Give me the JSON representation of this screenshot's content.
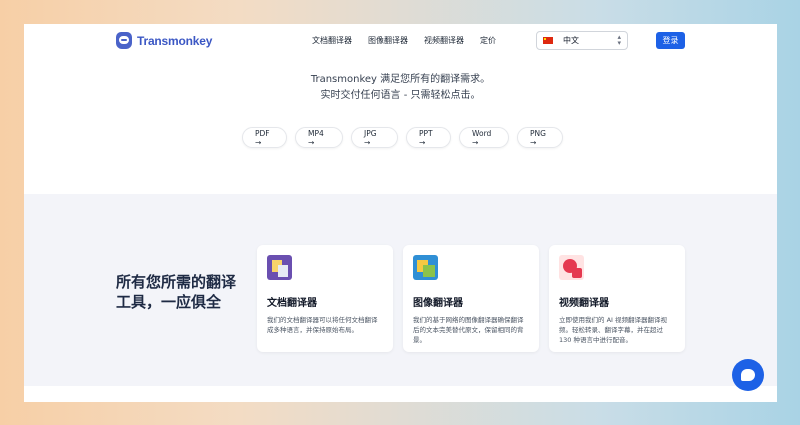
{
  "header": {
    "logo_text": "Transmonkey",
    "menu": [
      "文档翻译器",
      "图像翻译器",
      "视频翻译器",
      "定价"
    ],
    "language": "中文",
    "login_label": "登录"
  },
  "hero": {
    "line1": "Transmonkey 满足您所有的翻译需求。",
    "line2": "实时交付任何语言 - 只需轻松点击。"
  },
  "formats": [
    "PDF →",
    "MP4 →",
    "JPG →",
    "PPT →",
    "Word →",
    "PNG →"
  ],
  "tools": {
    "title": "所有您所需的翻译工具，一应俱全",
    "cards": [
      {
        "title": "文档翻译器",
        "desc": "我们的文档翻译器可以将任何文档翻译成多种语言，并保持原始布局。",
        "icon": "document-translate-icon"
      },
      {
        "title": "图像翻译器",
        "desc": "我们的基于网络的图像翻译器确保翻译后的文本完美替代原文，保留相同的背景。",
        "icon": "image-translate-icon"
      },
      {
        "title": "视频翻译器",
        "desc": "立即使用我们的 AI 视频翻译器翻译视频。轻松转录、翻译字幕，并在超过 130 种语言中进行配音。",
        "icon": "video-translate-icon"
      }
    ]
  },
  "colors": {
    "primary": "#1d61e6",
    "section_bg": "#f3f4f9",
    "heading": "#1e2a44"
  }
}
